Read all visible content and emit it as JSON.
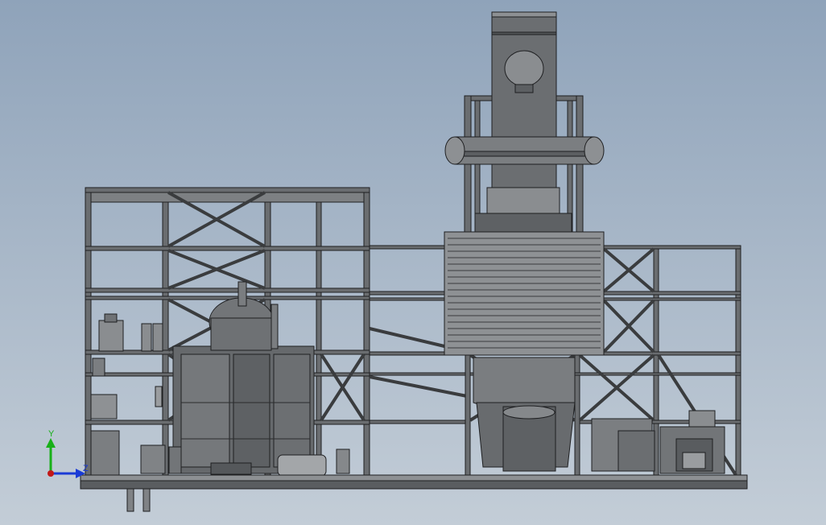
{
  "viewport": {
    "background_top": "#8fa3ba",
    "background_bottom": "#c3cdd7"
  },
  "model": {
    "steel_color": "#5a5d60",
    "steel_light": "#8b8e91",
    "equipment_color": "#6f7275",
    "panel_color": "#9ea1a4",
    "edge_color": "#1e1f21"
  },
  "triad": {
    "y_label": "Y",
    "z_label": "Z",
    "y_color": "#18b018",
    "z_color": "#1a3bd6",
    "x_color": "#c21818"
  }
}
